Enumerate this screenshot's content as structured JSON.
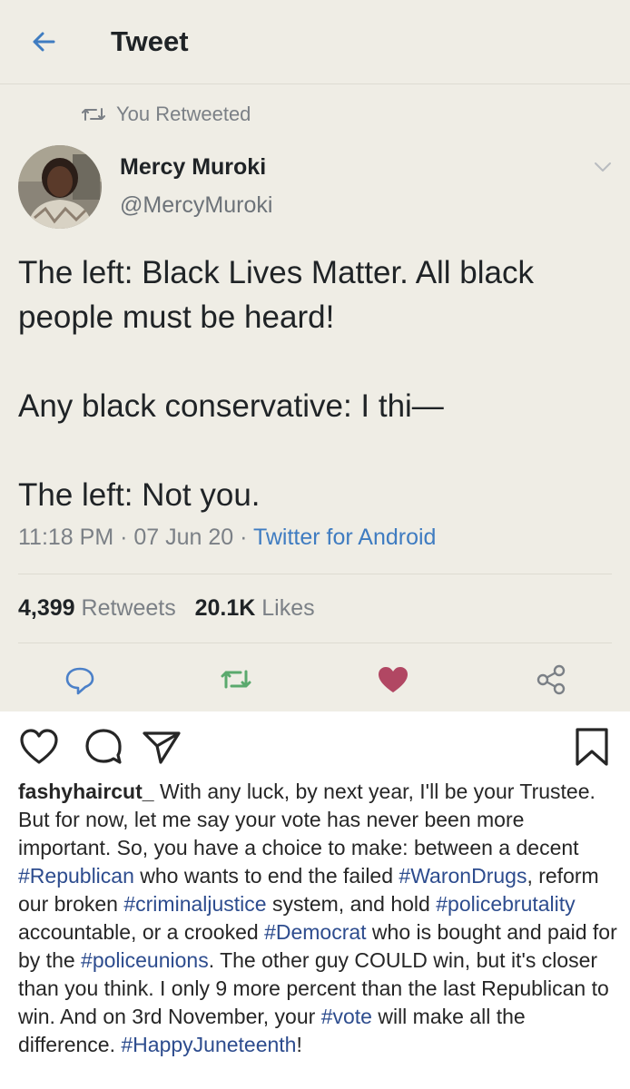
{
  "tweet_header": {
    "title": "Tweet",
    "back_icon": "arrow-left-icon"
  },
  "retweet_banner": {
    "text": "You Retweeted",
    "icon": "retweet-icon"
  },
  "author": {
    "name": "Mercy Muroki",
    "handle": "@MercyMuroki"
  },
  "tweet_text": "The left: Black Lives Matter. All black people must be heard!\n\nAny black conservative: I thi—\n\nThe left: Not you.",
  "meta": {
    "time": "11:18 PM",
    "separator": " · ",
    "date": "07 Jun 20",
    "source": "Twitter for Android"
  },
  "stats": {
    "retweets_count": "4,399",
    "retweets_label": "Retweets",
    "likes_count": "20.1K",
    "likes_label": "Likes"
  },
  "colors": {
    "tweet_bg": "#efede5",
    "link_blue": "#3f7cc1",
    "retweet_green": "#5aa96d",
    "like_red": "#b14763",
    "hashtag_blue": "#2d4c8e"
  },
  "caption": {
    "username": "fashyhaircut_",
    "segments": [
      {
        "t": " With any luck, by next year, I'll be your Trustee. But for now, let me say your vote has never been more important. So, you have a choice to make: between a decent ",
        "tag": false
      },
      {
        "t": "#Republican",
        "tag": true
      },
      {
        "t": " who wants to end the failed ",
        "tag": false
      },
      {
        "t": "#WaronDrugs",
        "tag": true
      },
      {
        "t": ", reform our broken ",
        "tag": false
      },
      {
        "t": "#criminaljustice",
        "tag": true
      },
      {
        "t": " system, and hold ",
        "tag": false
      },
      {
        "t": "#policebrutality",
        "tag": true
      },
      {
        "t": " accountable, or a crooked ",
        "tag": false
      },
      {
        "t": "#Democrat",
        "tag": true
      },
      {
        "t": " who is bought and paid for by the ",
        "tag": false
      },
      {
        "t": "#policeunions",
        "tag": true
      },
      {
        "t": ". The other guy COULD win, but it's closer than you think. I only 9 more percent than the last Republican to win. And on 3rd November, your ",
        "tag": false
      },
      {
        "t": "#vote",
        "tag": true
      },
      {
        "t": " will make all the difference. ",
        "tag": false
      },
      {
        "t": "#HappyJuneteenth",
        "tag": true
      },
      {
        "t": "!",
        "tag": false
      }
    ]
  }
}
